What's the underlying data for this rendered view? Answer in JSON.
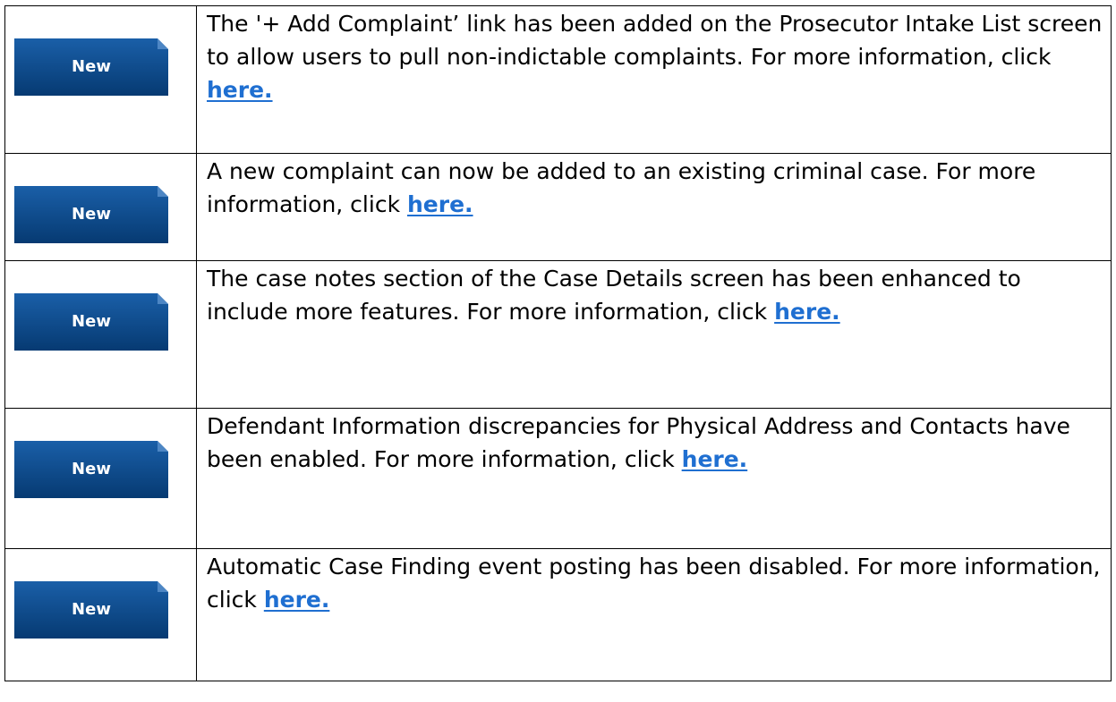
{
  "colors": {
    "badge_fill": "#0b4a8e",
    "badge_dark": "#063a72",
    "link": "#1f6fd1"
  },
  "rows": [
    {
      "badge": "New",
      "text": "The '+ Add Complaint’ link has been added on the Prosecutor Intake List screen to allow users to pull non-indictable complaints. For more information, click",
      "link": "here."
    },
    {
      "badge": "New",
      "text": "A new complaint can now be added to an existing criminal case. For more information, click",
      "link": "here."
    },
    {
      "badge": "New",
      "text": "The case notes section of the Case Details screen has been enhanced to include more features. For more information, click",
      "link": "here."
    },
    {
      "badge": "New",
      "text": "Defendant Information discrepancies for Physical Address and Contacts have been enabled. For more information, click",
      "link": "here."
    },
    {
      "badge": "New",
      "text": "Automatic Case Finding event posting has been disabled. For more information, click",
      "link": "here."
    }
  ]
}
